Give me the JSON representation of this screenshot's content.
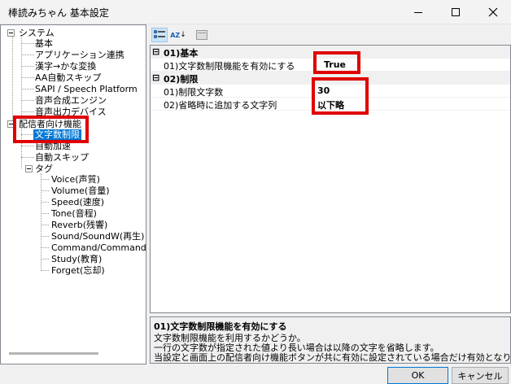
{
  "window": {
    "title": "棒読みちゃん 基本設定"
  },
  "tree": {
    "root": "システム",
    "system_items": [
      "基本",
      "アプリケーション連携",
      "漢字→かな変換",
      "AA自動スキップ",
      "SAPI / Speech Platform",
      "音声合成エンジン",
      "音声出力デバイス"
    ],
    "broadcaster": "配信者向け機能",
    "broadcaster_items": [
      "文字数制限",
      "自動加速",
      "自動スキップ"
    ],
    "tag": "タグ",
    "tag_items": [
      "Voice(声質)",
      "Volume(音量)",
      "Speed(速度)",
      "Tone(音程)",
      "Reverb(残響)",
      "Sound/SoundW(再生)",
      "Command/CommandW",
      "Study(教育)",
      "Forget(忘却)"
    ]
  },
  "toolbar": {
    "categorized_icon": "categorized-icon",
    "sort_az": "AZ",
    "pages_icon": "property-pages-icon"
  },
  "grid": {
    "cat1": "01)基本",
    "cat1_prop": "01)文字数制限機能を有効にする",
    "cat1_val": "True",
    "cat2": "02)制限",
    "cat2_prop1": "01)制限文字数",
    "cat2_val1": "30",
    "cat2_prop2": "02)省略時に追加する文字列",
    "cat2_val2": "以下略",
    "collapse_sym": "⊟"
  },
  "description": {
    "title": "01)文字数制限機能を有効にする",
    "line1": "文字数制限機能を利用するかどうか。",
    "line2": "一行の文字数が指定された値より長い場合は以降の文字を省略します。",
    "line3": "当設定と画面上の配信者向け機能ボタンが共に有効に設定されている場合だけ有効となり..."
  },
  "buttons": {
    "ok": "OK",
    "cancel": "キャンセル"
  },
  "colors": {
    "highlight": "#e00000",
    "selection": "#0078d7"
  }
}
